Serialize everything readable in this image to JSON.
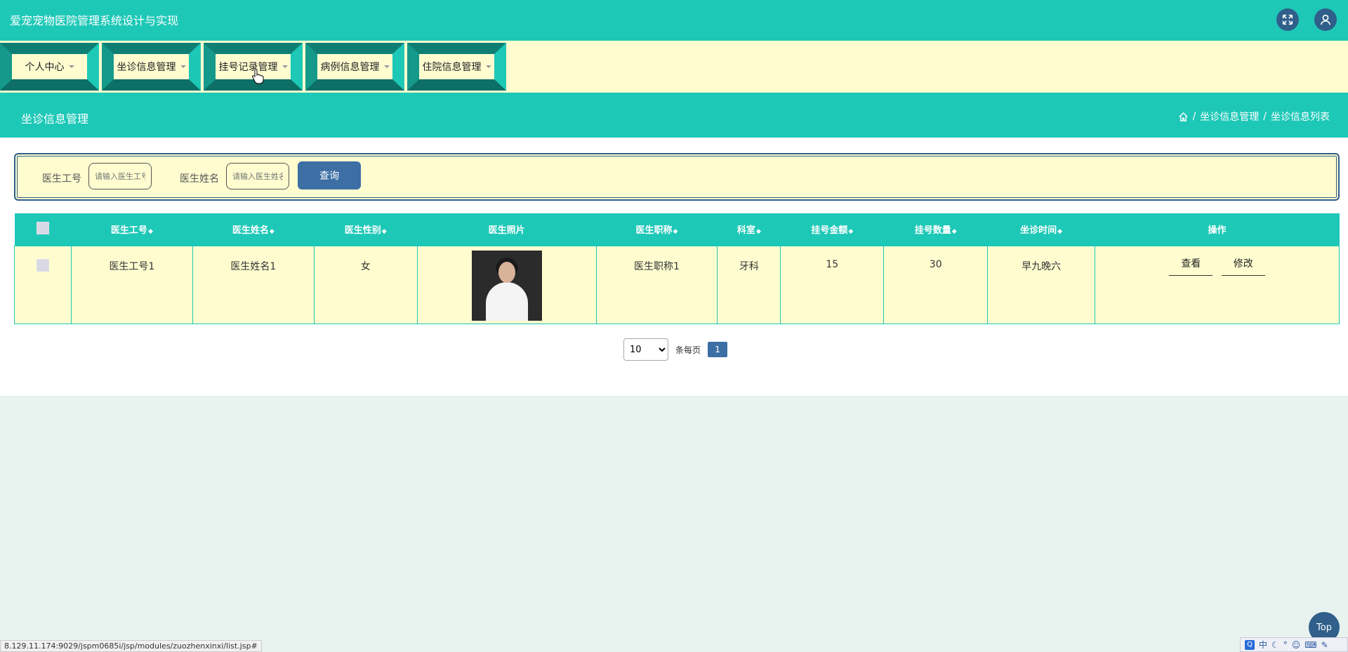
{
  "app": {
    "title": "爱宠宠物医院管理系统设计与实现"
  },
  "header_icons": [
    "fullscreen-icon",
    "user-icon"
  ],
  "nav": {
    "items": [
      {
        "label": "个人中心"
      },
      {
        "label": "坐诊信息管理"
      },
      {
        "label": "挂号记录管理"
      },
      {
        "label": "病例信息管理"
      },
      {
        "label": "住院信息管理"
      }
    ]
  },
  "page": {
    "title": "坐诊信息管理",
    "breadcrumb": [
      "坐诊信息管理",
      "坐诊信息列表"
    ]
  },
  "search": {
    "field1_label": "医生工号",
    "field1_placeholder": "请输入医生工号",
    "field2_label": "医生姓名",
    "field2_placeholder": "请输入医生姓名",
    "button": "查询"
  },
  "table": {
    "columns": [
      "医生工号",
      "医生姓名",
      "医生性别",
      "医生照片",
      "医生职称",
      "科室",
      "挂号金额",
      "挂号数量",
      "坐诊时间",
      "操作"
    ],
    "rows": [
      {
        "doctor_id": "医生工号1",
        "doctor_name": "医生姓名1",
        "gender": "女",
        "title": "医生职称1",
        "department": "牙科",
        "fee": "15",
        "quantity": "30",
        "schedule": "早九晚六",
        "view_label": "查看",
        "edit_label": "修改"
      }
    ]
  },
  "pager": {
    "page_size": "10",
    "page_size_options": [
      "10"
    ],
    "per_page_label": "条每页",
    "current_page": "1"
  },
  "top_button": "Top",
  "status_url": "8.129.11.174:9029/jspm0685i/jsp/modules/zuozhenxinxi/list.jsp#",
  "ime": {
    "lang": "中"
  },
  "colors": {
    "teal": "#1ec8b7",
    "cream": "#fffdd0",
    "navy": "#2f5f8a",
    "button_blue": "#3d6fa5"
  }
}
